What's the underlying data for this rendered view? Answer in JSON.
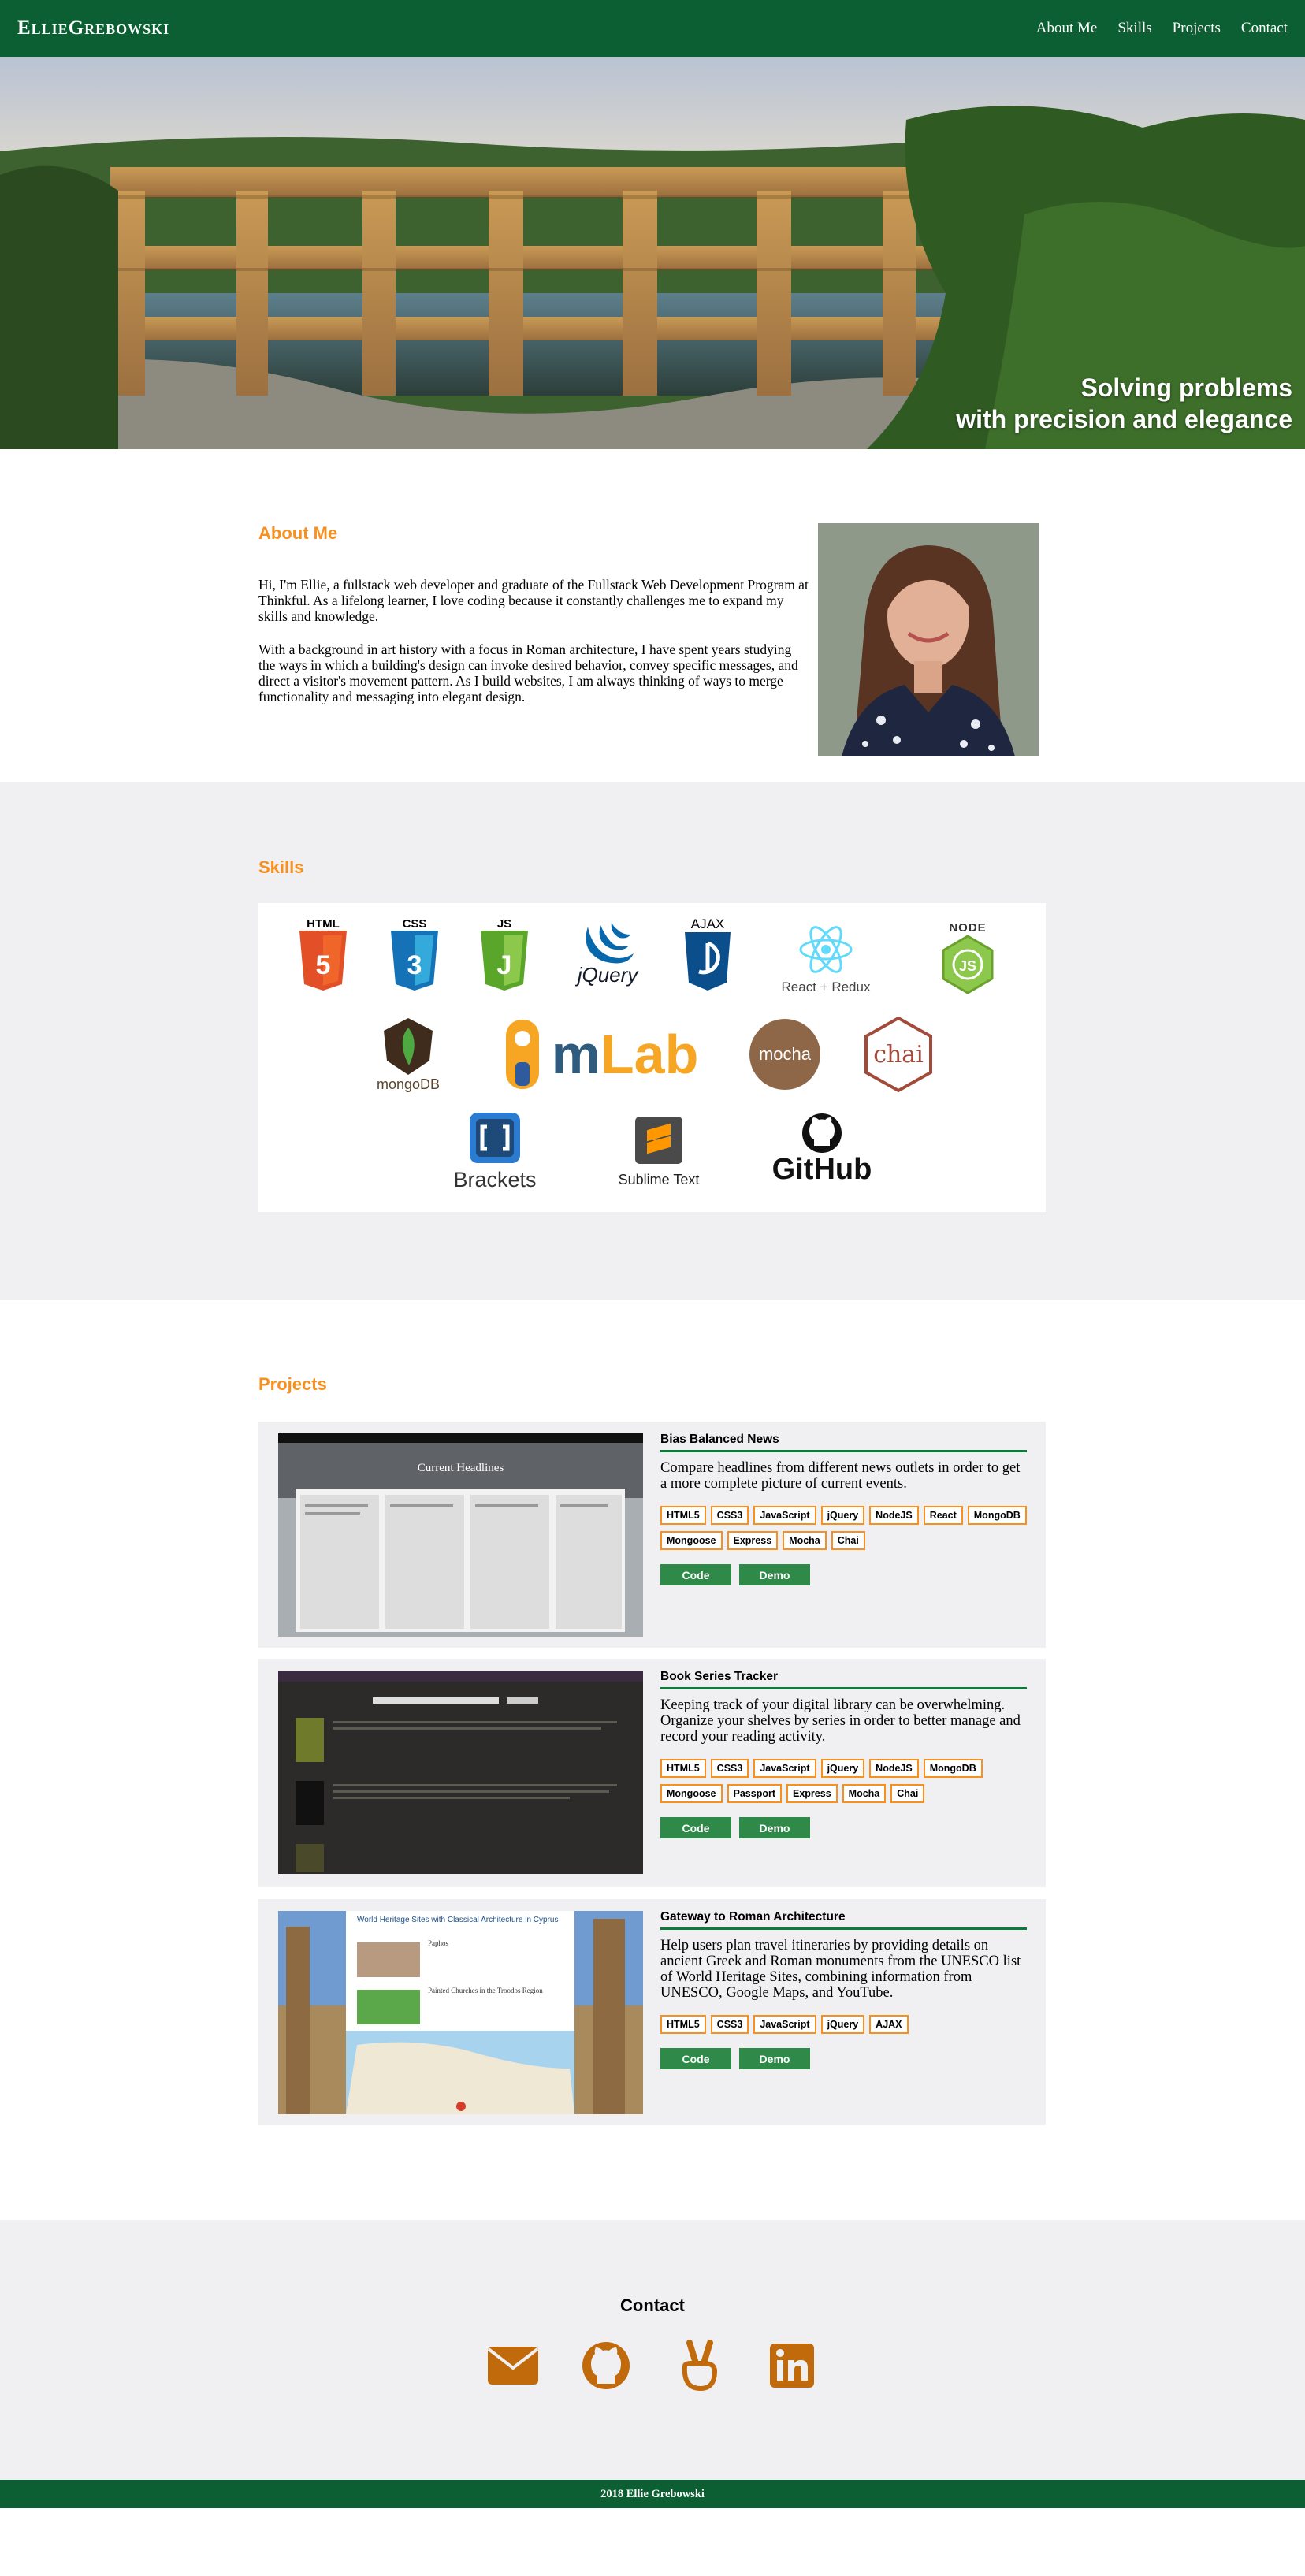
{
  "nav": {
    "brand": "EllieGrebowski",
    "links": [
      "About Me",
      "Skills",
      "Projects",
      "Contact"
    ]
  },
  "hero": {
    "tagline_line1": "Solving problems",
    "tagline_line2": "with precision and elegance"
  },
  "about": {
    "title": "About Me",
    "paragraph1": "Hi, I'm Ellie, a fullstack web developer and graduate of the Fullstack Web Development Program at Thinkful. As a lifelong learner, I love coding because it constantly challenges me to expand my skills and knowledge.",
    "paragraph2": "With a background in art history with a focus in Roman architecture, I have spent years studying the ways in which a building's design can invoke desired behavior, convey specific messages, and direct a visitor's movement pattern. As I build websites, I am always thinking of ways to merge functionality and messaging into elegant design."
  },
  "skills": {
    "title": "Skills",
    "logos": {
      "html": "HTML",
      "html_num": "5",
      "css": "CSS",
      "css_num": "3",
      "js": "JS",
      "js_letter": "J",
      "jquery": "jQuery",
      "ajax": "AJAX",
      "react": "React + Redux",
      "node": "NODE",
      "node_js": "JS",
      "mongodb": "mongoDB",
      "mlab": "mLab",
      "mocha": "mocha",
      "chai": "chai",
      "brackets": "Brackets",
      "sublime": "Sublime Text",
      "github": "GitHub"
    }
  },
  "projects": {
    "title": "Projects",
    "code_label": "Code",
    "demo_label": "Demo",
    "items": [
      {
        "title": "Bias Balanced News",
        "description": "Compare headlines from different news outlets in order to get a more complete picture of current events.",
        "tags": [
          "HTML5",
          "CSS3",
          "JavaScript",
          "jQuery",
          "NodeJS",
          "React",
          "MongoDB",
          "Mongoose",
          "Express",
          "Mocha",
          "Chai"
        ],
        "shot_heading": "Current Headlines"
      },
      {
        "title": "Book Series Tracker",
        "description": "Keeping track of your digital library can be overwhelming. Organize your shelves by series in order to better manage and record your reading activity.",
        "tags": [
          "HTML5",
          "CSS3",
          "JavaScript",
          "jQuery",
          "NodeJS",
          "MongoDB",
          "Mongoose",
          "Passport",
          "Express",
          "Mocha",
          "Chai"
        ]
      },
      {
        "title": "Gateway to Roman Architecture",
        "description": "Help users plan travel itineraries by providing details on ancient Greek and Roman monuments from the UNESCO list of World Heritage Sites, combining information from UNESCO, Google Maps, and YouTube.",
        "tags": [
          "HTML5",
          "CSS3",
          "JavaScript",
          "jQuery",
          "AJAX"
        ],
        "shot_heading": "World Heritage Sites with Classical Architecture in Cyprus",
        "shot_item1": "Paphos",
        "shot_item2": "Painted Churches in the Troodos Region"
      }
    ]
  },
  "contact": {
    "title": "Contact",
    "icons": [
      "envelope-icon",
      "github-icon",
      "angellist-icon",
      "linkedin-icon"
    ],
    "accent": "#c06a0c"
  },
  "footer": {
    "text": "2018 Ellie Grebowski"
  },
  "colors": {
    "brand_green": "#0c5f32",
    "accent_orange": "#f7901e",
    "button_green": "#2f8a4a",
    "section_gray": "#f0f0f2"
  }
}
